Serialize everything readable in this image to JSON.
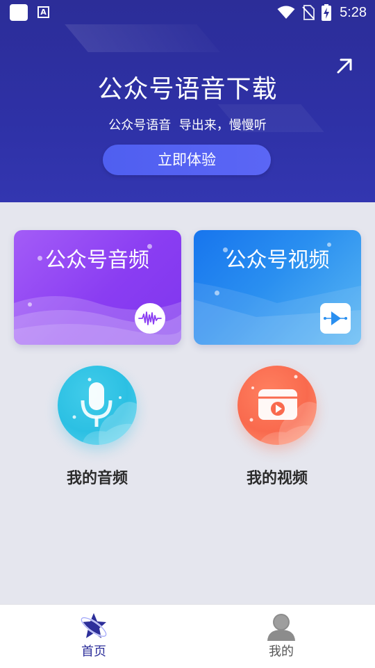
{
  "status_bar": {
    "time": "5:28",
    "a_indicator": "A",
    "icons": [
      "app-square-icon",
      "text-a-icon",
      "wifi-icon",
      "no-sim-icon",
      "battery-charging-icon"
    ]
  },
  "banner": {
    "title": "公众号语音下载",
    "subtitle": "公众号语音  导出来，慢慢听",
    "cta_label": "立即体验",
    "expand_icon": "arrow-up-right-icon"
  },
  "cards": [
    {
      "title": "公众号音频",
      "icon": "audio-waveform-icon",
      "colors": [
        "#a35cf7",
        "#7f36ee"
      ]
    },
    {
      "title": "公众号视频",
      "icon": "video-play-icon",
      "colors": [
        "#1775ee",
        "#5bb8f3"
      ]
    }
  ],
  "shortcuts": [
    {
      "label": "我的音频",
      "icon": "microphone-icon",
      "color": "#2cc0e3"
    },
    {
      "label": "我的视频",
      "icon": "video-folder-icon",
      "color": "#f96a4e"
    }
  ],
  "bottom_nav": {
    "items": [
      {
        "label": "首页",
        "icon": "star-planet-icon",
        "active": true
      },
      {
        "label": "我的",
        "icon": "user-avatar-icon",
        "active": false
      }
    ],
    "active_color": "#2d2f9a"
  }
}
